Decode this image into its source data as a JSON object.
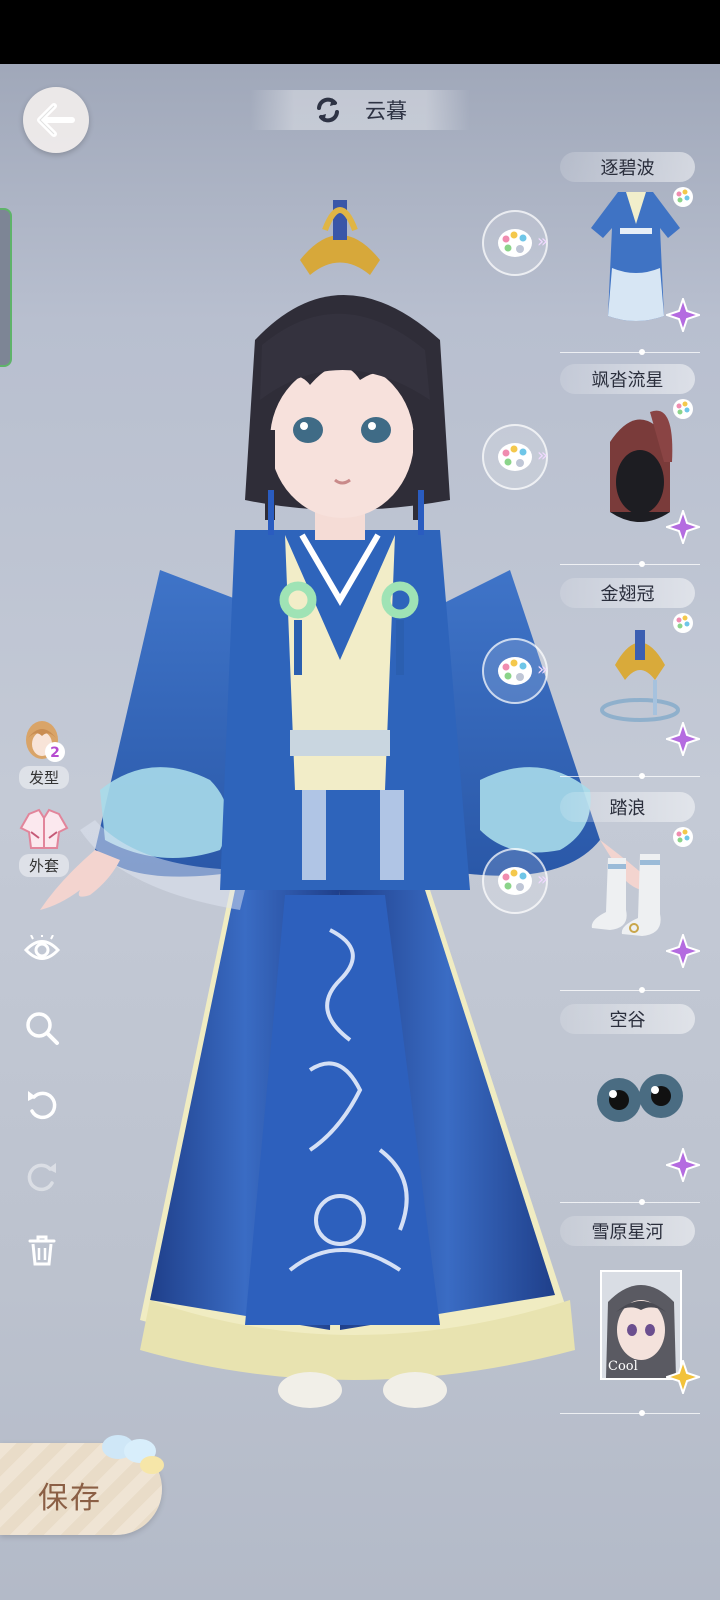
{
  "header": {
    "outfit_name": "云暮",
    "back_icon": "back-arrow-icon",
    "switch_icon": "swap-icon"
  },
  "left_tools": [
    {
      "label": "发型",
      "icon": "hairstyle-icon",
      "badge": "2"
    },
    {
      "label": "外套",
      "icon": "coat-icon"
    }
  ],
  "icon_tools": [
    "visibility-eye-icon",
    "zoom-icon",
    "undo-icon",
    "redo-icon",
    "trash-icon"
  ],
  "slots": [
    {
      "label": "逐碧波",
      "item": "robe"
    },
    {
      "label": "飒沓流星",
      "item": "hair"
    },
    {
      "label": "金翅冠",
      "item": "crown"
    },
    {
      "label": "踏浪",
      "item": "boots"
    },
    {
      "label": "空谷",
      "item": "eyes"
    },
    {
      "label": "雪原星河",
      "item": "face-makeup",
      "thumb_text": "Cool"
    }
  ],
  "save_label": "保存",
  "colors": {
    "robe_blue": "#2f5fb5",
    "accent_purple": "#b46be0",
    "accent_gold": "#f2c23a"
  }
}
